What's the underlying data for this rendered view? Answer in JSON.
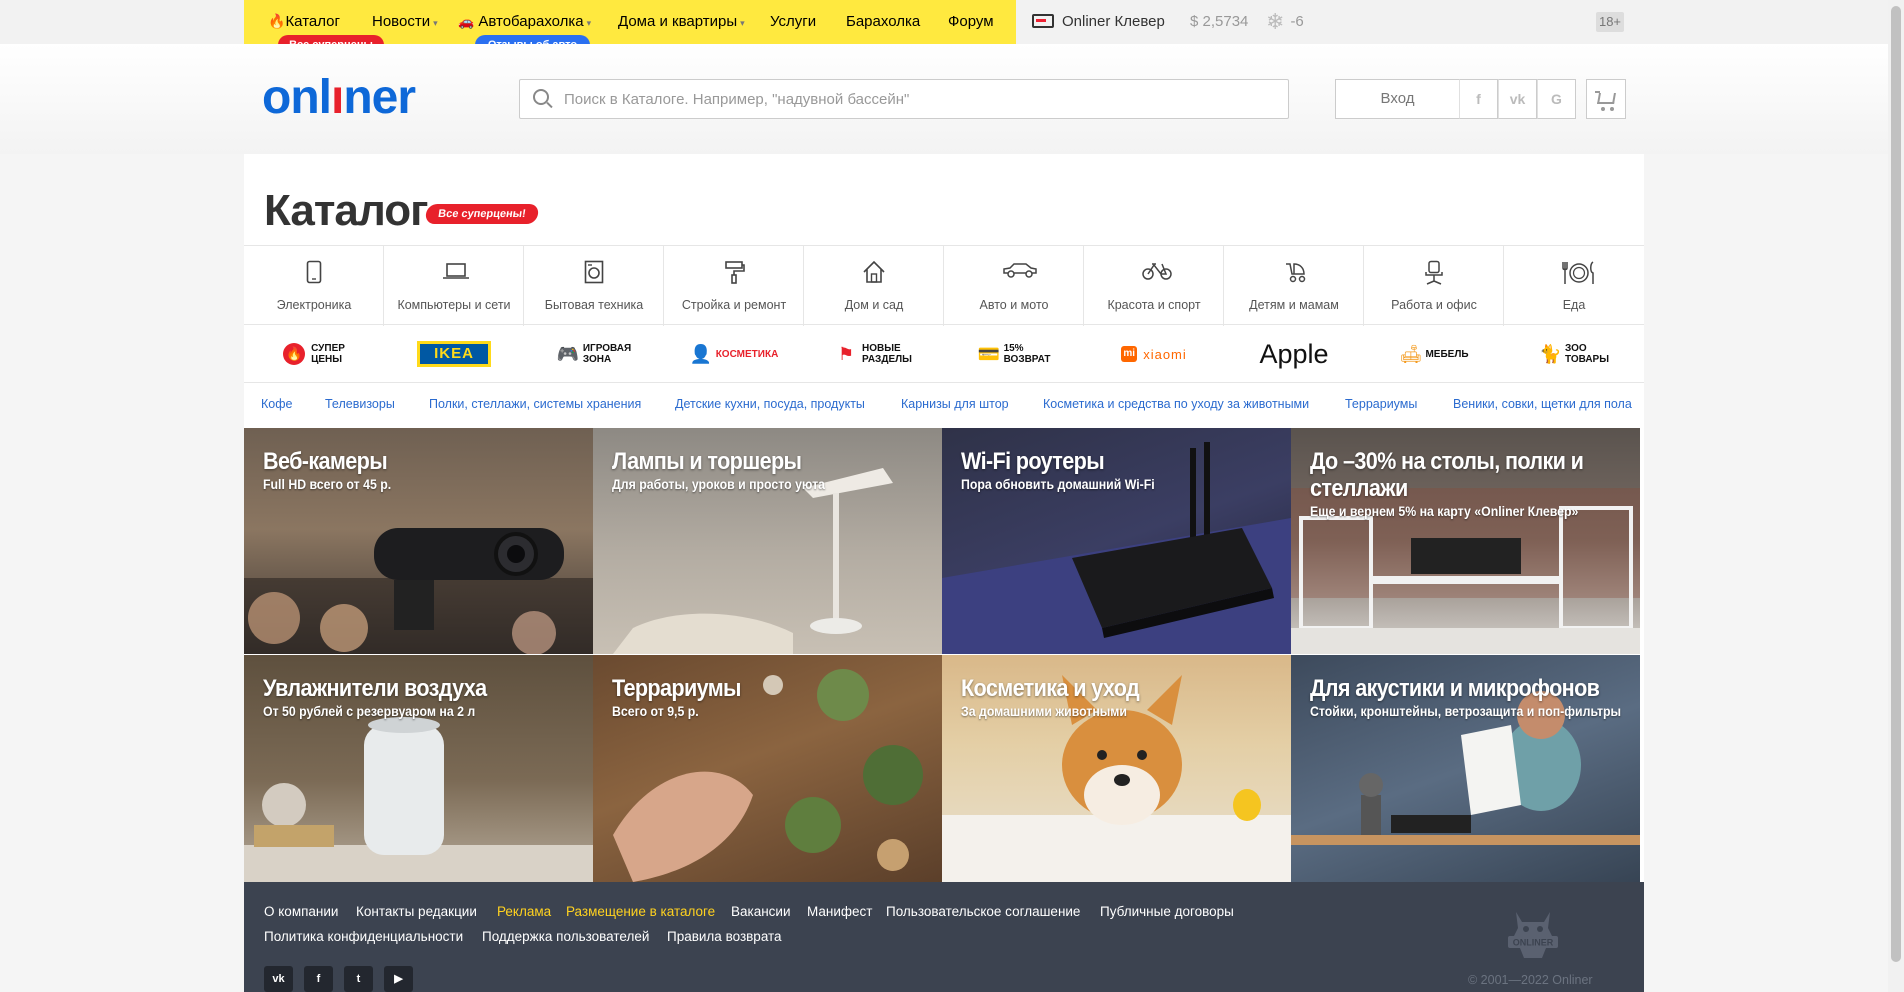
{
  "topnav": {
    "items": [
      {
        "label": "Каталог"
      },
      {
        "label": "Новости"
      },
      {
        "label": "Автобарахолка"
      },
      {
        "label": "Дома и квартиры"
      },
      {
        "label": "Услуги"
      },
      {
        "label": "Барахолка"
      },
      {
        "label": "Форум"
      }
    ],
    "badge_catalog": "Все суперцены",
    "badge_auto": "Отзывы об авто",
    "clever": "Onliner Клевер",
    "currency": "$ 2,5734",
    "temperature": "-6",
    "age": "18+"
  },
  "header": {
    "logo_a": "onl",
    "logo_b": "ı",
    "logo_c": "ner",
    "search_placeholder": "Поиск в Каталоге. Например, \"надувной бассейн\"",
    "login": "Вход",
    "social": [
      "f",
      "vk",
      "G"
    ]
  },
  "catalog": {
    "title": "Каталог",
    "title_badge": "Все суперцены!",
    "categories": [
      {
        "label": "Электроника",
        "icon": "smartphone-icon"
      },
      {
        "label": "Компьютеры и сети",
        "icon": "laptop-icon"
      },
      {
        "label": "Бытовая техника",
        "icon": "washing-machine-icon"
      },
      {
        "label": "Стройка и ремонт",
        "icon": "paint-roller-icon"
      },
      {
        "label": "Дом и сад",
        "icon": "house-icon"
      },
      {
        "label": "Авто и мото",
        "icon": "car-icon"
      },
      {
        "label": "Красота и спорт",
        "icon": "bicycle-icon"
      },
      {
        "label": "Детям и мамам",
        "icon": "stroller-icon"
      },
      {
        "label": "Работа и офис",
        "icon": "office-chair-icon"
      },
      {
        "label": "Еда",
        "icon": "plate-icon"
      }
    ],
    "brands": [
      {
        "l1": "СУПЕР",
        "l2": "ЦЕНЫ"
      },
      {
        "l1": "IKEA"
      },
      {
        "l1": "ИГРОВАЯ",
        "l2": "ЗОНА"
      },
      {
        "l1": "КОСМЕТИКА"
      },
      {
        "l1": "НОВЫЕ",
        "l2": "РАЗДЕЛЫ"
      },
      {
        "l1": "15%",
        "l2": "ВОЗВРАТ"
      },
      {
        "l1": "xiaomi"
      },
      {
        "l1": "Apple"
      },
      {
        "l1": "МЕБЕЛЬ"
      },
      {
        "l1": "ЗОО",
        "l2": "ТОВАРЫ"
      }
    ],
    "quick_links": [
      "Кофе",
      "Телевизоры",
      "Полки, стеллажи, системы хранения",
      "Детские кухни, посуда, продукты",
      "Карнизы для штор",
      "Косметика и средства по уходу за животными",
      "Террариумы",
      "Веники, совки, щетки для пола"
    ],
    "tiles": [
      {
        "title": "Веб-камеры",
        "subtitle": "Full HD всего от 45 р."
      },
      {
        "title": "Лампы и торшеры",
        "subtitle": "Для работы, уроков и просто уюта"
      },
      {
        "title": "Wi-Fi роутеры",
        "subtitle": "Пора обновить домашний Wi-Fi"
      },
      {
        "title": "До –30% на столы, полки и стеллажи",
        "subtitle": "Еще и вернем 5% на карту «Onliner Клевер»"
      },
      {
        "title": "Увлажнители воздуха",
        "subtitle": "От 50 рублей с резервуаром на 2 л"
      },
      {
        "title": "Террариумы",
        "subtitle": "Всего от 9,5 р."
      },
      {
        "title": "Косметика и уход",
        "subtitle": "За домашними животными"
      },
      {
        "title": "Для акустики и микрофонов",
        "subtitle": "Стойки, кронштейны, ветрозащита и поп-фильтры"
      }
    ]
  },
  "footer": {
    "row1": [
      "О компании",
      "Контакты редакции",
      "Реклама",
      "Размещение в каталоге",
      "Вакансии",
      "Манифест",
      "Пользовательское соглашение",
      "Публичные договоры"
    ],
    "row2": [
      "Политика конфиденциальности",
      "Поддержка пользователей",
      "Правила возврата"
    ],
    "social": [
      "vk",
      "f",
      "t",
      "▶"
    ],
    "mascot_text": "ONLINER",
    "copyright": "© 2001—2022 Onliner"
  },
  "colors": {
    "yellow": "#ffe93f",
    "brand_blue": "#0e68d8",
    "brand_red": "#e8212b",
    "footer": "#3c4350",
    "link": "#2b6bcf"
  }
}
